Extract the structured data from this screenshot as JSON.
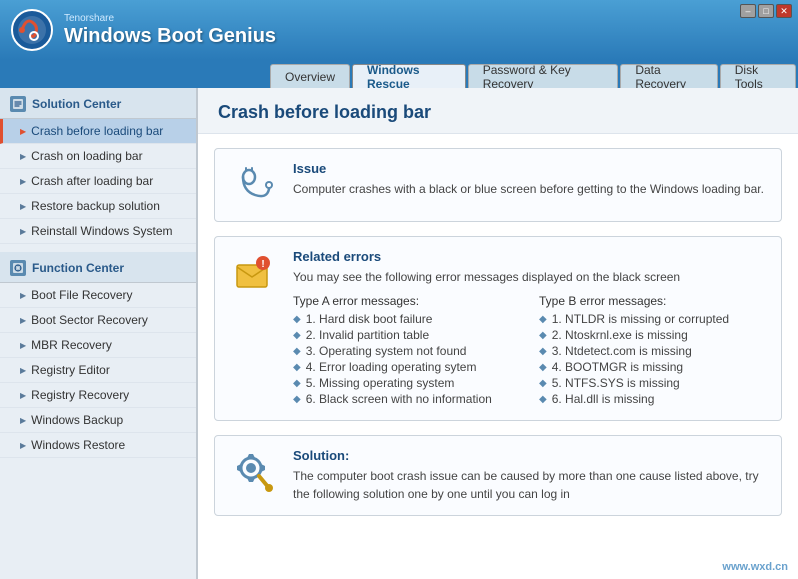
{
  "app": {
    "vendor": "Tenorshare",
    "title": "Windows Boot Genius"
  },
  "titlebar": {
    "min": "–",
    "max": "□",
    "close": "✕"
  },
  "nav": {
    "tabs": [
      {
        "label": "Overview",
        "active": false
      },
      {
        "label": "Windows Rescue",
        "active": true
      },
      {
        "label": "Password & Key Recovery",
        "active": false
      },
      {
        "label": "Data Recovery",
        "active": false
      },
      {
        "label": "Disk Tools",
        "active": false
      }
    ]
  },
  "sidebar": {
    "solution_center": {
      "title": "Solution Center",
      "items": [
        {
          "label": "Crash before loading bar",
          "active": true
        },
        {
          "label": "Crash on loading bar",
          "active": false
        },
        {
          "label": "Crash after loading bar",
          "active": false
        },
        {
          "label": "Restore backup solution",
          "active": false
        },
        {
          "label": "Reinstall Windows System",
          "active": false
        }
      ]
    },
    "function_center": {
      "title": "Function Center",
      "items": [
        {
          "label": "Boot File Recovery",
          "active": false
        },
        {
          "label": "Boot Sector Recovery",
          "active": false
        },
        {
          "label": "MBR Recovery",
          "active": false
        },
        {
          "label": "Registry Editor",
          "active": false
        },
        {
          "label": "Registry Recovery",
          "active": false
        },
        {
          "label": "Windows Backup",
          "active": false
        },
        {
          "label": "Windows Restore",
          "active": false
        }
      ]
    }
  },
  "content": {
    "title": "Crash before loading bar",
    "issue": {
      "heading": "Issue",
      "text": "Computer crashes with a black or blue screen before getting to the Windows loading bar."
    },
    "related_errors": {
      "heading": "Related errors",
      "text": "You may see the following error messages displayed on the black screen",
      "type_a_title": "Type A error messages:",
      "type_a_items": [
        "1. Hard disk boot failure",
        "2. Invalid partition table",
        "3. Operating system not found",
        "4. Error loading operating sytem",
        "5. Missing operating system",
        "6. Black screen with no information"
      ],
      "type_b_title": "Type B error messages:",
      "type_b_items": [
        "1. NTLDR is missing or corrupted",
        "2. Ntoskrnl.exe is missing",
        "3. Ntdetect.com is missing",
        "4. BOOTMGR is missing",
        "5. NTFS.SYS is missing",
        "6. Hal.dll is missing"
      ]
    },
    "solution": {
      "heading": "Solution:",
      "text": "The computer boot crash issue can be caused by more than one cause listed above, try the following solution one by one until you can log in"
    }
  },
  "watermark": "www.wxd.cn"
}
